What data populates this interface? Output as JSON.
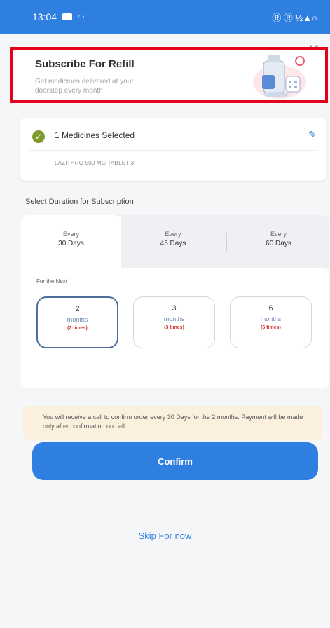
{
  "status_bar": {
    "time": "13:04",
    "indicators": "Ⓡ Ⓡ ½▲○"
  },
  "close_icon": "✕",
  "banner": {
    "title": "Subscribe For Refill",
    "subtitle": "Get medicines delivered at your doorstep every month",
    "highlight_color": "#e5001b"
  },
  "selection": {
    "count_label": "1 Medicines Selected",
    "medicine": "LAZITHRO 500 MG TABLET 3"
  },
  "duration": {
    "section_label": "Select Duration for Subscription",
    "tabs": [
      {
        "line1": "Every",
        "line2": "30 Days",
        "selected": true
      },
      {
        "line1": "Every",
        "line2": "45 Days",
        "selected": false
      },
      {
        "line1": "Every",
        "line2": "60 Days",
        "selected": false
      }
    ],
    "for_next_label": "For the Next",
    "options": [
      {
        "number": "2",
        "unit": "months",
        "times": "(2 times)",
        "selected": true
      },
      {
        "number": "3",
        "unit": "months",
        "times": "(3 times)",
        "selected": false
      },
      {
        "number": "6",
        "unit": "months",
        "times": "(6 times)",
        "selected": false
      }
    ]
  },
  "note": "You will receive a call to confirm order every 30 Days for the 2 months. Payment will be made only after confirmation on call.",
  "confirm_label": "Confirm",
  "skip_label": "Skip For now",
  "colors": {
    "accent": "#2f7fe0",
    "check": "#7d9a2f",
    "note_bg": "#fbf0dd"
  }
}
